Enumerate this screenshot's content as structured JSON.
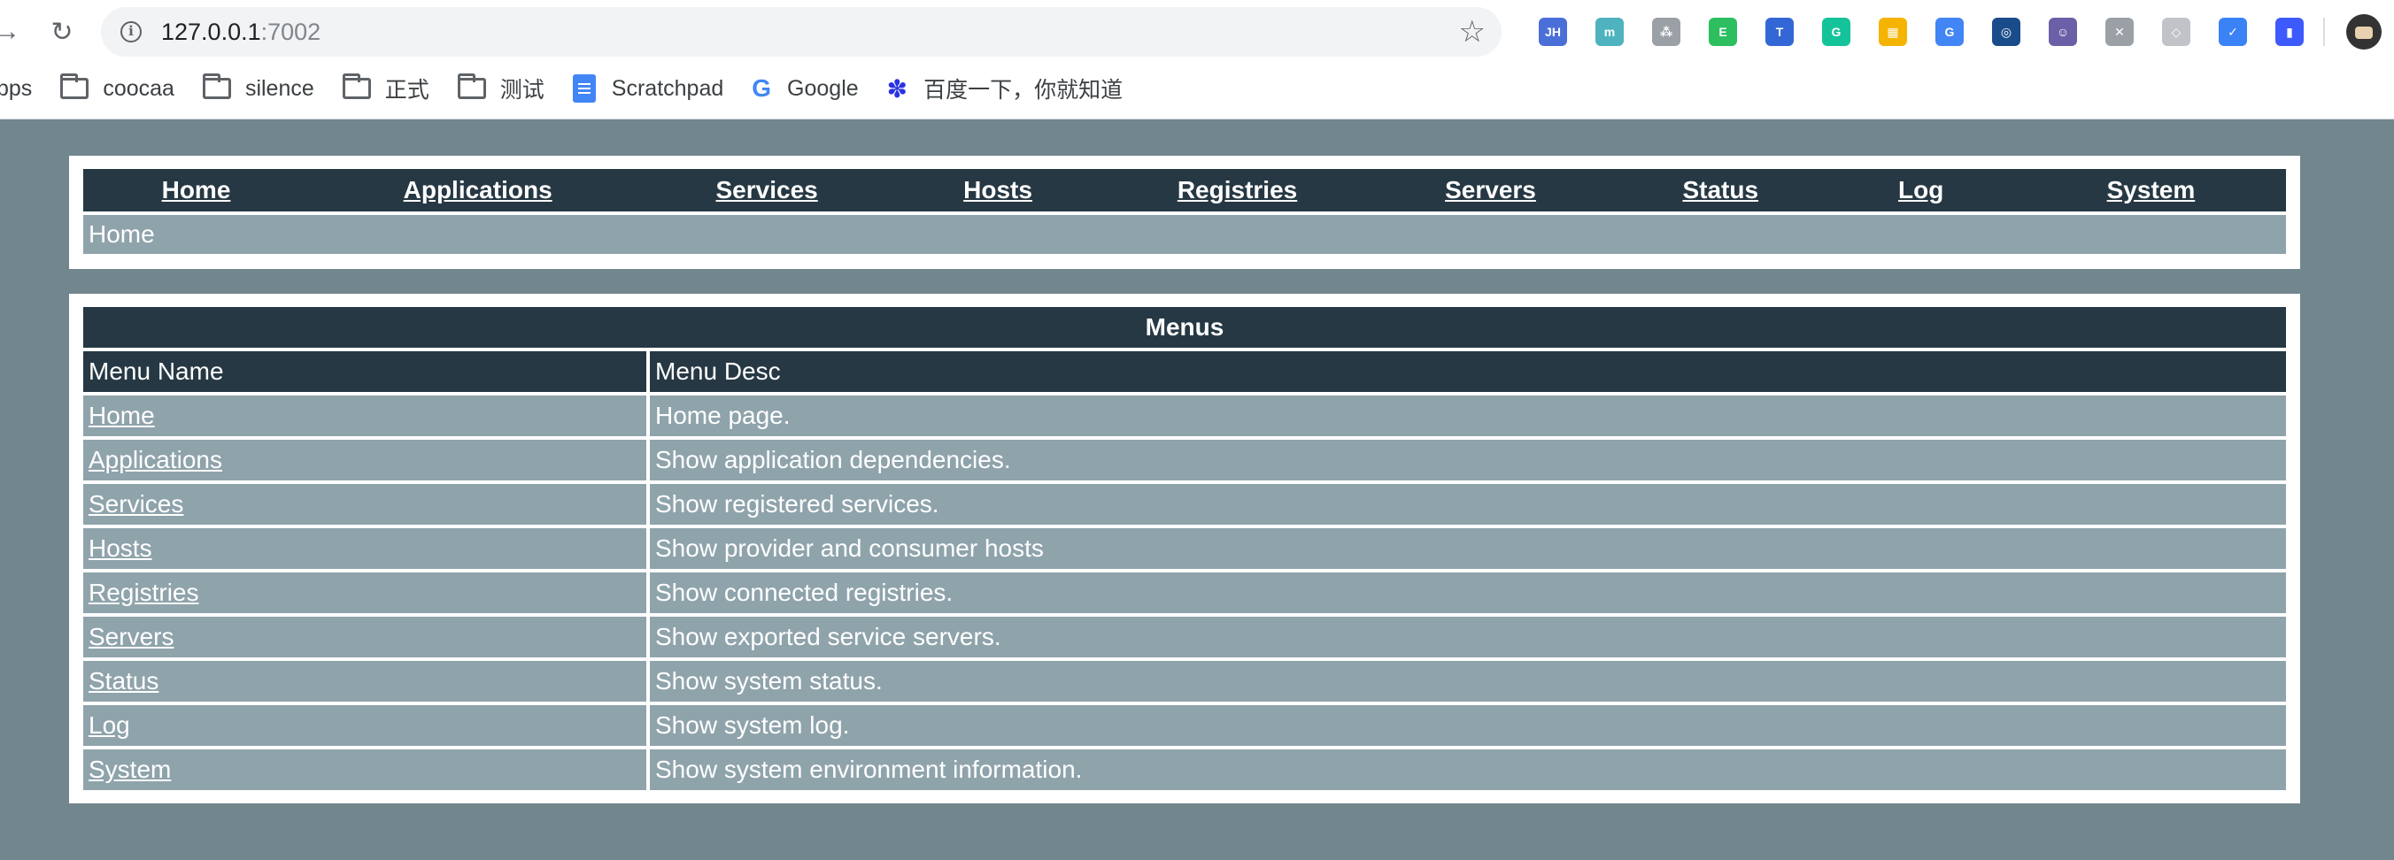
{
  "browser": {
    "url_host": "127.0.0.1",
    "url_port": ":7002",
    "extensions": [
      {
        "icon": "jh-icon",
        "text": "JH",
        "color": "#4a6fd8"
      },
      {
        "icon": "circle-m-icon",
        "text": "m",
        "color": "#4fb3bf"
      },
      {
        "icon": "sitemap-icon",
        "text": "⁂",
        "color": "#9aa0a6"
      },
      {
        "icon": "evernote-icon",
        "text": "E",
        "color": "#2dbe60"
      },
      {
        "icon": "translate-icon",
        "text": "T",
        "color": "#3367d6"
      },
      {
        "icon": "grammarly-icon",
        "text": "G",
        "color": "#15c39a"
      },
      {
        "icon": "grid-icon",
        "text": "▦",
        "color": "#f4b400"
      },
      {
        "icon": "google-translate-icon",
        "text": "G",
        "color": "#4285f4"
      },
      {
        "icon": "target-icon",
        "text": "◎",
        "color": "#1a4c8b"
      },
      {
        "icon": "cat-icon",
        "text": "☺",
        "color": "#6b5fa8"
      },
      {
        "icon": "person-icon",
        "text": "✕",
        "color": "#9aa0a6"
      },
      {
        "icon": "shield-icon",
        "text": "◇",
        "color": "#c0c4c8"
      },
      {
        "icon": "check-icon",
        "text": "✓",
        "color": "#3b82f6"
      },
      {
        "icon": "lighthouse-icon",
        "text": "▮",
        "color": "#3d5afe"
      }
    ],
    "bookmarks": [
      {
        "icon": "apps-icon",
        "label": "pps"
      },
      {
        "icon": "folder-icon",
        "label": "coocaa"
      },
      {
        "icon": "folder-icon",
        "label": "silence"
      },
      {
        "icon": "folder-icon",
        "label": "正式"
      },
      {
        "icon": "folder-icon",
        "label": "测试"
      },
      {
        "icon": "doc-icon",
        "label": "Scratchpad"
      },
      {
        "icon": "google-icon",
        "label": "Google"
      },
      {
        "icon": "baidu-icon",
        "label": "百度一下，你就知道"
      }
    ]
  },
  "nav": {
    "links": [
      "Home",
      "Applications",
      "Services",
      "Hosts",
      "Registries",
      "Servers",
      "Status",
      "Log",
      "System"
    ],
    "breadcrumb": "Home"
  },
  "menus": {
    "title": "Menus",
    "col_name": "Menu Name",
    "col_desc": "Menu Desc",
    "rows": [
      {
        "name": "Home",
        "desc": "Home page."
      },
      {
        "name": "Applications",
        "desc": "Show application dependencies."
      },
      {
        "name": "Services",
        "desc": "Show registered services."
      },
      {
        "name": "Hosts",
        "desc": "Show provider and consumer hosts"
      },
      {
        "name": "Registries",
        "desc": "Show connected registries."
      },
      {
        "name": "Servers",
        "desc": "Show exported service servers."
      },
      {
        "name": "Status",
        "desc": "Show system status."
      },
      {
        "name": "Log",
        "desc": "Show system log."
      },
      {
        "name": "System",
        "desc": "Show system environment information."
      }
    ]
  }
}
